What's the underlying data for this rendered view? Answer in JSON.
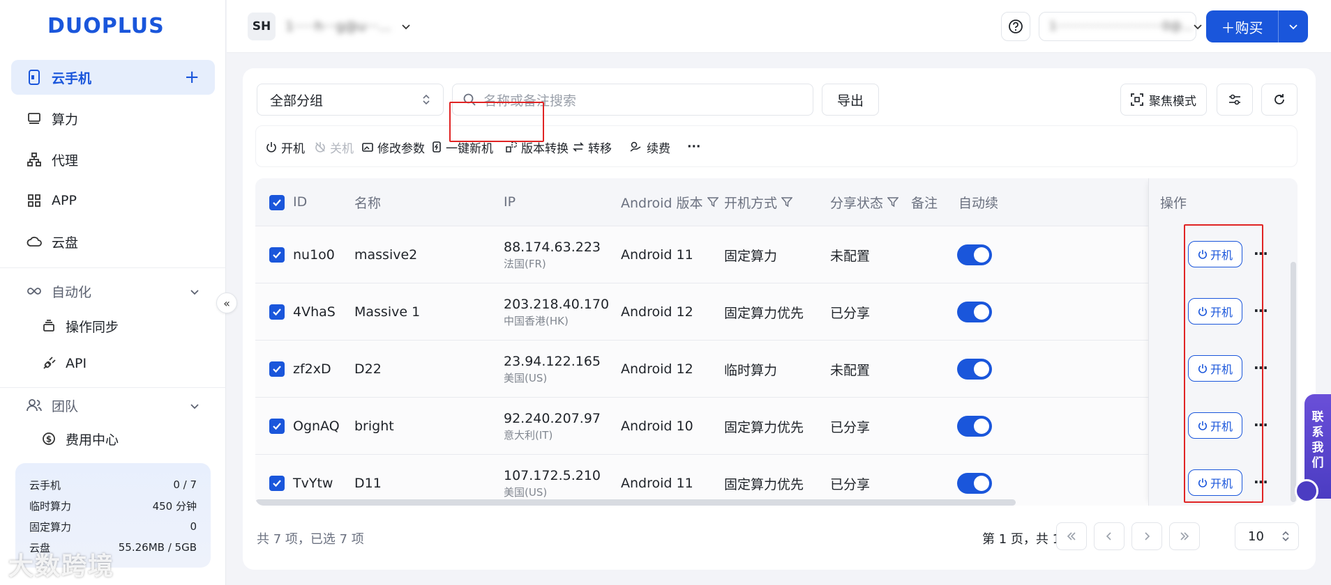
{
  "brand": {
    "logo_text": "DUOPLUS"
  },
  "sidebar": {
    "items": [
      {
        "label": "云手机",
        "action": "+"
      },
      {
        "label": "算力"
      },
      {
        "label": "代理"
      },
      {
        "label": "APP"
      },
      {
        "label": "云盘"
      }
    ],
    "automation": {
      "label": "自动化",
      "sub": [
        "操作同步",
        "API"
      ]
    },
    "team": {
      "label": "团队",
      "sub": [
        "费用中心"
      ]
    },
    "usage": [
      {
        "label": "云手机",
        "value": "0 / 7"
      },
      {
        "label": "临时算力",
        "value": "450 分钟"
      },
      {
        "label": "固定算力",
        "value": "0"
      },
      {
        "label": "云盘",
        "value": "55.26MB / 5GB"
      }
    ],
    "collapse": "«",
    "watermark": "大数跨境"
  },
  "header": {
    "avatar": "SH",
    "account": "1·····h···g@u···...",
    "user_select": "1····························0@...",
    "buy": "＋购买"
  },
  "filters": {
    "group": "全部分组",
    "search_placeholder": "名称或备注搜索",
    "export": "导出",
    "focus_mode": "聚焦模式"
  },
  "toolbar": [
    "开机",
    "关机",
    "修改参数",
    "一键新机",
    "版本转换",
    "转移",
    "续费",
    "···"
  ],
  "table": {
    "headers": [
      "ID",
      "名称",
      "IP",
      "Android 版本",
      "开机方式",
      "分享状态",
      "备注",
      "自动续",
      "操作"
    ],
    "rows": [
      {
        "id": "nu1o0",
        "name": "massive2",
        "ip": "88.174.63.223",
        "region": "法国(FR)",
        "android": "Android 11",
        "boot": "固定算力",
        "share": "未配置",
        "action": "开机"
      },
      {
        "id": "4VhaS",
        "name": "Massive 1",
        "ip": "203.218.40.170",
        "region": "中国香港(HK)",
        "android": "Android 12",
        "boot": "固定算力优先",
        "share": "已分享",
        "action": "开机"
      },
      {
        "id": "zf2xD",
        "name": "D22",
        "ip": "23.94.122.165",
        "region": "美国(US)",
        "android": "Android 12",
        "boot": "临时算力",
        "share": "未配置",
        "action": "开机"
      },
      {
        "id": "OgnAQ",
        "name": "bright",
        "ip": "92.240.207.97",
        "region": "意大利(IT)",
        "android": "Android 10",
        "boot": "固定算力优先",
        "share": "已分享",
        "action": "开机"
      },
      {
        "id": "TvYtw",
        "name": "D11",
        "ip": "107.172.5.210",
        "region": "美国(US)",
        "android": "Android 11",
        "boot": "固定算力优先",
        "share": "已分享",
        "action": "开机"
      }
    ],
    "more": "···"
  },
  "footer": {
    "total": "共 7 项，已选 7 项",
    "page_info": "第 1 页，共 1 页",
    "page_size": "10"
  },
  "contact": {
    "label_lines": [
      "联",
      "系",
      "我",
      "们"
    ]
  },
  "colors": {
    "primary": "#1a56db",
    "highlight": "#e02424",
    "contact": "#5a45d0"
  }
}
